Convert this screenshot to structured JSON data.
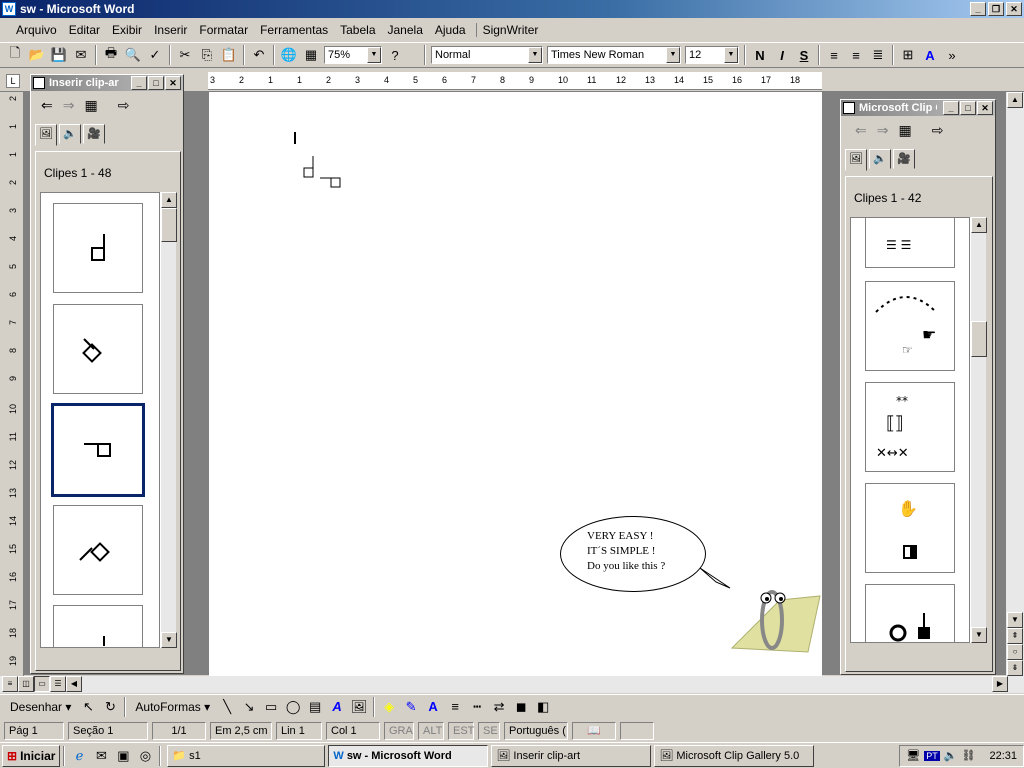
{
  "window": {
    "title": "sw - Microsoft Word"
  },
  "menu": [
    "Arquivo",
    "Editar",
    "Exibir",
    "Inserir",
    "Formatar",
    "Ferramentas",
    "Tabela",
    "Janela",
    "Ajuda",
    "SignWriter"
  ],
  "toolbar": {
    "zoom": "75%",
    "style": "Normal",
    "font": "Times New Roman",
    "size": "12",
    "bold": "N",
    "italic": "I",
    "strike": "S"
  },
  "left_panel": {
    "title": "Inserir clip-art",
    "clips_label": "Clipes 1 - 48"
  },
  "right_panel": {
    "title": "Microsoft Clip Gallery 5.0",
    "clips_label": "Clipes 1 - 42"
  },
  "ruler": {
    "marks": [
      "3",
      "2",
      "1",
      "1",
      "2",
      "3",
      "4",
      "5",
      "6",
      "7",
      "8",
      "9",
      "10",
      "11",
      "12",
      "13",
      "14",
      "15",
      "16",
      "17",
      "18"
    ]
  },
  "vruler": {
    "marks": [
      "2",
      "1",
      "1",
      "2",
      "3",
      "4",
      "5",
      "6",
      "7",
      "8",
      "9",
      "10",
      "11",
      "12",
      "13",
      "14",
      "15",
      "16",
      "17",
      "18",
      "19"
    ]
  },
  "bubble": {
    "line1": "VERY EASY !",
    "line2": "IT´S SIMPLE !",
    "line3": "Do you like this ?"
  },
  "drawbar": {
    "draw": "Desenhar",
    "autoshapes": "AutoFormas"
  },
  "status": {
    "page": "Pág  1",
    "section": "Seção  1",
    "pages": "1/1",
    "pos": "Em  2,5 cm",
    "line": "Lin  1",
    "col": "Col  1",
    "rec": "GRA",
    "alt": "ALT",
    "est": "EST",
    "se": "SE",
    "lang": "Português ("
  },
  "taskbar": {
    "start": "Iniciar",
    "tasks": [
      "s1",
      "sw - Microsoft Word",
      "Inserir clip-art",
      "Microsoft Clip Gallery 5.0"
    ],
    "time": "22:31",
    "lang": "PT"
  }
}
